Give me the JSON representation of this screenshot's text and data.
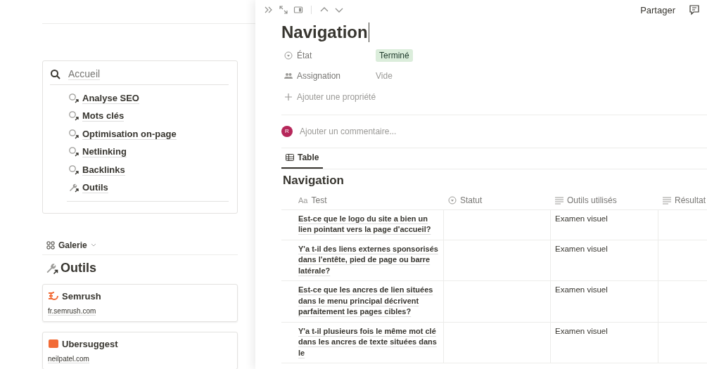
{
  "left_page": {
    "search": {
      "label": "Accueil"
    },
    "links": [
      {
        "label": "Analyse SEO",
        "kind": "search"
      },
      {
        "label": "Mots clés",
        "kind": "search"
      },
      {
        "label": "Optimisation on-page",
        "kind": "search"
      },
      {
        "label": "Netlinking",
        "kind": "search"
      },
      {
        "label": "Backlinks",
        "kind": "search"
      },
      {
        "label": "Outils",
        "kind": "tool"
      }
    ],
    "view": {
      "label": "Galerie"
    },
    "heading": "Outils",
    "cards": [
      {
        "title": "Semrush",
        "url": "fr.semrush.com",
        "kind": "flame"
      },
      {
        "title": "Ubersuggest",
        "url": "neilpatel.com",
        "kind": "square"
      }
    ]
  },
  "panel": {
    "share": "Partager",
    "title": "Navigation",
    "properties": [
      {
        "name": "État",
        "kind": "status",
        "value": "Terminé"
      },
      {
        "name": "Assignation",
        "kind": "people",
        "value": "Vide"
      }
    ],
    "add_property": "Ajouter une propriété",
    "comment": {
      "avatar": "R",
      "placeholder": "Ajouter un commentaire..."
    },
    "tabs": [
      {
        "label": "Table",
        "selected": true
      }
    ],
    "table": {
      "title": "Navigation",
      "columns": [
        {
          "label": "Test",
          "kind": "title",
          "type_label": "Aa"
        },
        {
          "label": "Statut",
          "kind": "status"
        },
        {
          "label": "Outils utilisés",
          "kind": "text"
        },
        {
          "label": "Résultat",
          "kind": "text"
        }
      ],
      "rows": [
        [
          "Est-ce que le logo du site a bien un lien pointant vers la page d'accueil?",
          "",
          "Examen visuel",
          ""
        ],
        [
          "Y'a t-il des liens externes sponsorisés dans l'entête, pied de page ou barre latérale?",
          "",
          "Examen visuel",
          ""
        ],
        [
          "Est-ce que les ancres de lien situées dans le menu principal décrivent parfaitement les pages cibles?",
          "",
          "Examen visuel",
          ""
        ],
        [
          "Y'a t-il plusieurs fois le même mot clé dans les ancres de texte situées dans le",
          "",
          "Examen visuel",
          ""
        ]
      ]
    }
  }
}
